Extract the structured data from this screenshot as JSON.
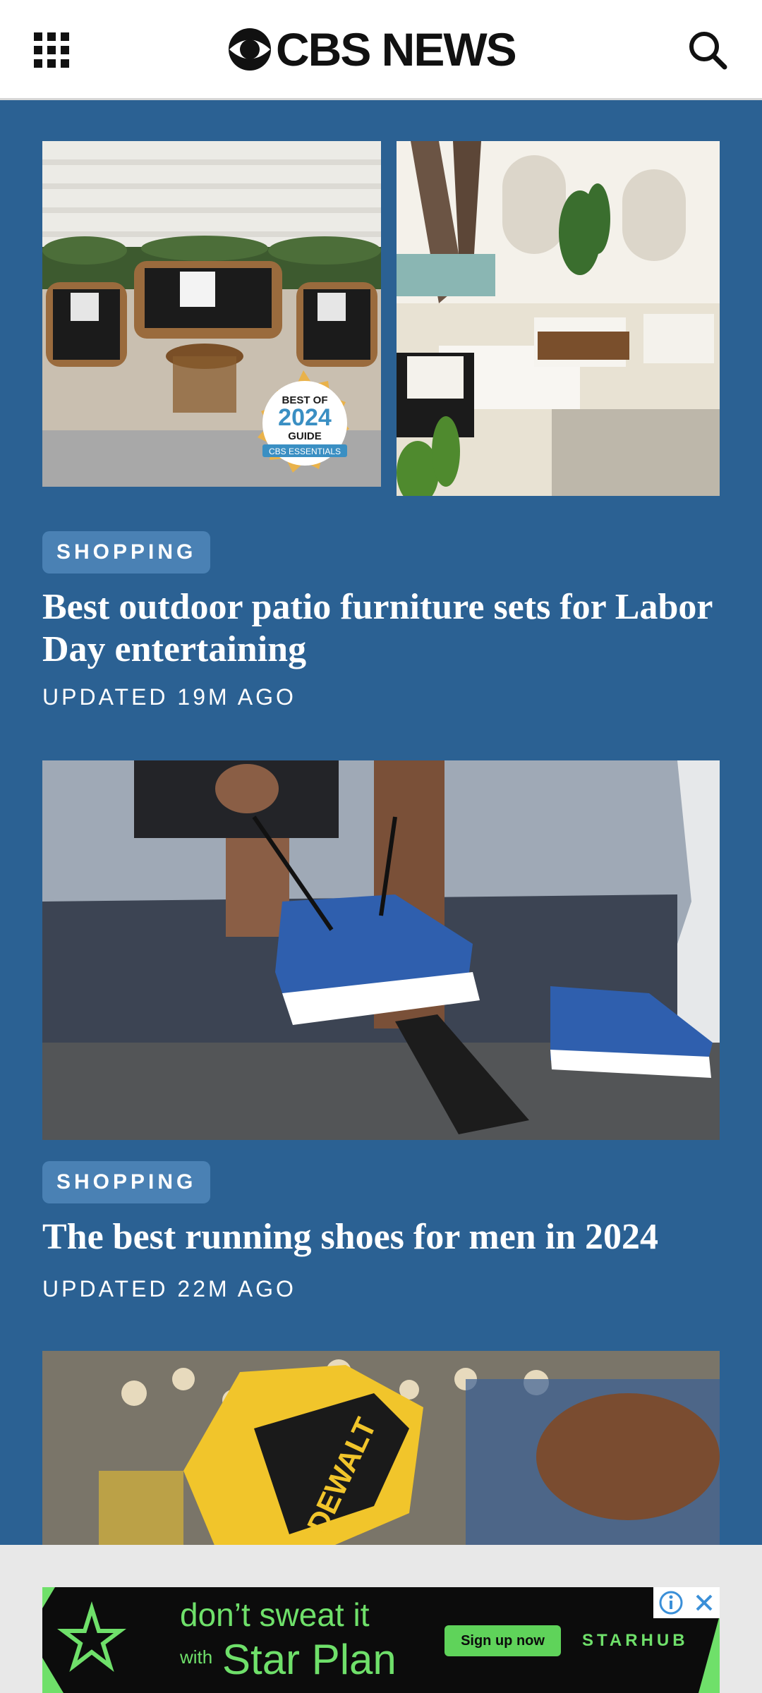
{
  "header": {
    "brand": "CBS NEWS",
    "menu_icon": "grid-menu-icon",
    "search_icon": "search-icon"
  },
  "articles": [
    {
      "category": "SHOPPING",
      "title": "Best outdoor patio furniture sets for Labor Day entertaining",
      "updated": "UPDATED 19M AGO",
      "badge": {
        "line1": "BEST OF",
        "year": "2024",
        "line3": "GUIDE",
        "line4": "CBS ESSENTIALS"
      }
    },
    {
      "category": "SHOPPING",
      "title": "The best running shoes for men in 2024",
      "updated": "UPDATED 22M AGO"
    },
    {
      "image_text": "DEWALT"
    }
  ],
  "ad": {
    "headline": "don’t sweat it",
    "subline_prefix": "with",
    "subline": "Star Plan",
    "cta": "Sign up now",
    "brand": "STARHUB"
  },
  "colors": {
    "feed_background": "#2b6193",
    "pill_background": "#4a81b4",
    "ad_green": "#6fe06a"
  }
}
